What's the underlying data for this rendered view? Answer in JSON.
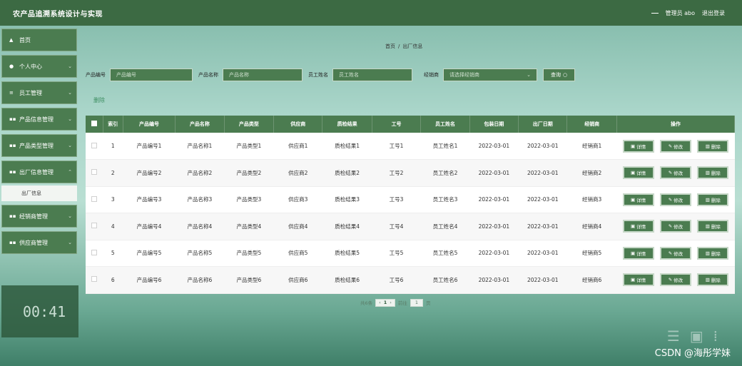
{
  "header": {
    "title": "农产品追溯系统设计与实现",
    "user_label": "管理员 abo",
    "logout_label": "退出登录"
  },
  "sidebar": {
    "items": [
      {
        "label": "首页",
        "icon": "home-icon"
      },
      {
        "label": "个人中心",
        "icon": "user-icon"
      },
      {
        "label": "员工管理",
        "icon": "list-icon"
      },
      {
        "label": "产品信息管理",
        "icon": "grid-icon"
      },
      {
        "label": "产品类型管理",
        "icon": "grid-icon"
      },
      {
        "label": "出厂信息管理",
        "icon": "grid-icon"
      },
      {
        "label": "经销商管理",
        "icon": "grid-icon"
      },
      {
        "label": "供应商管理",
        "icon": "grid-icon"
      }
    ],
    "active_sub": "出厂信息",
    "clock": "00:41"
  },
  "breadcrumb": {
    "home": "首页",
    "current": "出厂信息"
  },
  "filters": {
    "product_code_label": "产品编号",
    "product_code_placeholder": "产品编号",
    "product_name_label": "产品名称",
    "product_name_placeholder": "产品名称",
    "employee_name_label": "员工姓名",
    "employee_name_placeholder": "员工姓名",
    "dealer_label": "经销商",
    "dealer_placeholder": "请选择经销商",
    "search_label": "查询"
  },
  "actions": {
    "delete_label": "删除"
  },
  "table": {
    "headers": [
      "索引",
      "产品编号",
      "产品名称",
      "产品类型",
      "供应商",
      "质检结果",
      "工号",
      "员工姓名",
      "包装日期",
      "出厂日期",
      "经销商",
      "操作"
    ],
    "rows": [
      [
        "1",
        "产品编号1",
        "产品名称1",
        "产品类型1",
        "供应商1",
        "质检结果1",
        "工号1",
        "员工姓名1",
        "2022-03-01",
        "2022-03-01",
        "经销商1"
      ],
      [
        "2",
        "产品编号2",
        "产品名称2",
        "产品类型2",
        "供应商2",
        "质检结果2",
        "工号2",
        "员工姓名2",
        "2022-03-01",
        "2022-03-01",
        "经销商2"
      ],
      [
        "3",
        "产品编号3",
        "产品名称3",
        "产品类型3",
        "供应商3",
        "质检结果3",
        "工号3",
        "员工姓名3",
        "2022-03-01",
        "2022-03-01",
        "经销商3"
      ],
      [
        "4",
        "产品编号4",
        "产品名称4",
        "产品类型4",
        "供应商4",
        "质检结果4",
        "工号4",
        "员工姓名4",
        "2022-03-01",
        "2022-03-01",
        "经销商4"
      ],
      [
        "5",
        "产品编号5",
        "产品名称5",
        "产品类型5",
        "供应商5",
        "质检结果5",
        "工号5",
        "员工姓名5",
        "2022-03-01",
        "2022-03-01",
        "经销商5"
      ],
      [
        "6",
        "产品编号6",
        "产品名称6",
        "产品类型6",
        "供应商6",
        "质检结果6",
        "工号6",
        "员工姓名6",
        "2022-03-01",
        "2022-03-01",
        "经销商6"
      ]
    ],
    "op_labels": {
      "detail": "详情",
      "edit": "修改",
      "delete": "删除"
    }
  },
  "pagination": {
    "total_text": "共6条",
    "current_page": "1",
    "goto_prefix": "前往",
    "goto_value": "1",
    "goto_suffix": "页"
  },
  "watermark": "CSDN @海彤学妹",
  "colors": {
    "primary": "#4b7c50",
    "header": "#3c6a43"
  }
}
